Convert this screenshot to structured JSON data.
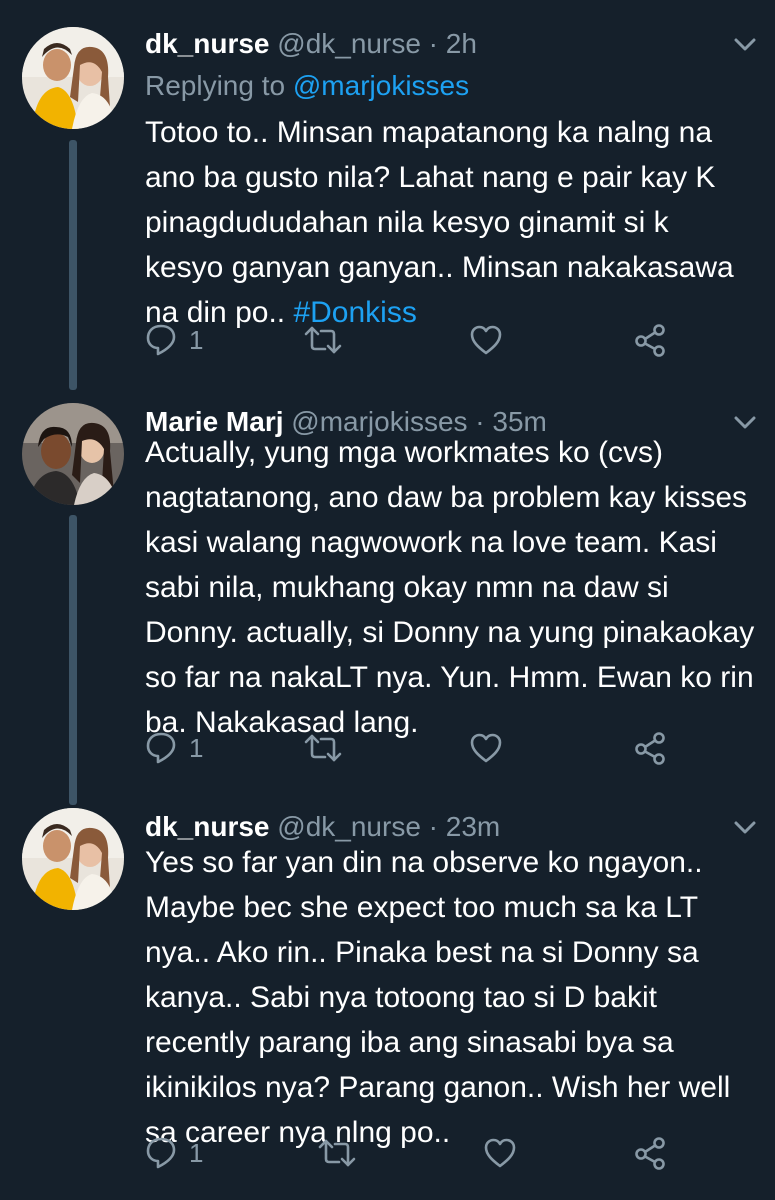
{
  "tweets": [
    {
      "name": "dk_nurse",
      "meta": " @dk_nurse · 2h",
      "replying_prefix": "Replying to ",
      "replying_to": "@marjokisses",
      "text": "Totoo to.. Minsan mapatanong ka nalng na\nano ba gusto nila? Lahat nang e pair kay K\npinagdududahan nila kesyo ginamit si k\nkesyo ganyan ganyan.. Minsan nakakasawa\nna din po.. ",
      "hashtag": "#Donkiss",
      "reply_count": "1"
    },
    {
      "name": "Marie Marj",
      "meta": " @marjokisses · 35m",
      "text": "Actually, yung mga workmates ko (cvs)\nnagtatanong, ano daw ba problem kay kisses\nkasi walang nagwowork na love team. Kasi\nsabi nila, mukhang okay nmn na daw si\nDonny. actually, si Donny na yung pinakaokay\nso far na nakaLT nya. Yun. Hmm. Ewan ko rin\nba. Nakakasad lang.",
      "reply_count": "1"
    },
    {
      "name": "dk_nurse",
      "meta": " @dk_nurse · 23m",
      "text": "Yes so far yan din na observe ko ngayon..\nMaybe bec she expect too much sa ka LT\nnya.. Ako rin.. Pinaka best na si Donny sa\nkanya.. Sabi nya totoong tao si D bakit\nrecently parang iba ang sinasabi bya sa\nikinikilos nya? Parang ganon.. Wish her well\nsa career nya nlng po..",
      "reply_count": "1"
    }
  ],
  "icons": {
    "reply": "reply-icon",
    "retweet": "retweet-icon",
    "like": "heart-icon",
    "share": "share-icon",
    "more": "chevron-down-icon"
  },
  "colors": {
    "background": "#15202b",
    "text": "#ffffff",
    "secondary": "#8899a6",
    "accent": "#1da1f2",
    "thread_line": "#3d5466"
  }
}
